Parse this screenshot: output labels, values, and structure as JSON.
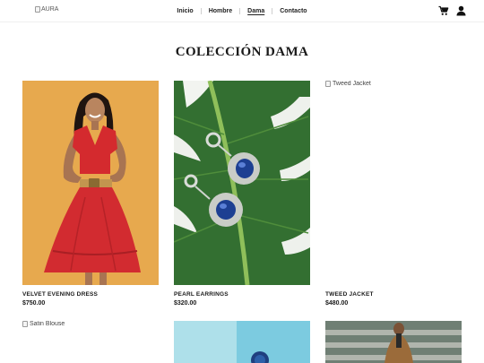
{
  "header": {
    "logo_alt": "AURA",
    "nav": [
      {
        "label": "Inicio"
      },
      {
        "label": "Hombre"
      },
      {
        "label": "Dama"
      },
      {
        "label": "Contacto"
      }
    ]
  },
  "page": {
    "title": "COLECCIÓN DAMA"
  },
  "products": [
    {
      "name": "VELVET EVENING DRESS",
      "price": "$750.00"
    },
    {
      "name": "PEARL EARRINGS",
      "price": "$320.00"
    },
    {
      "name": "TWEED JACKET",
      "price": "$480.00",
      "image_alt": "Tweed Jacket"
    },
    {
      "image_alt": "Satin Blouse"
    }
  ],
  "icons": {
    "cart": "cart-icon",
    "user": "user-icon"
  }
}
